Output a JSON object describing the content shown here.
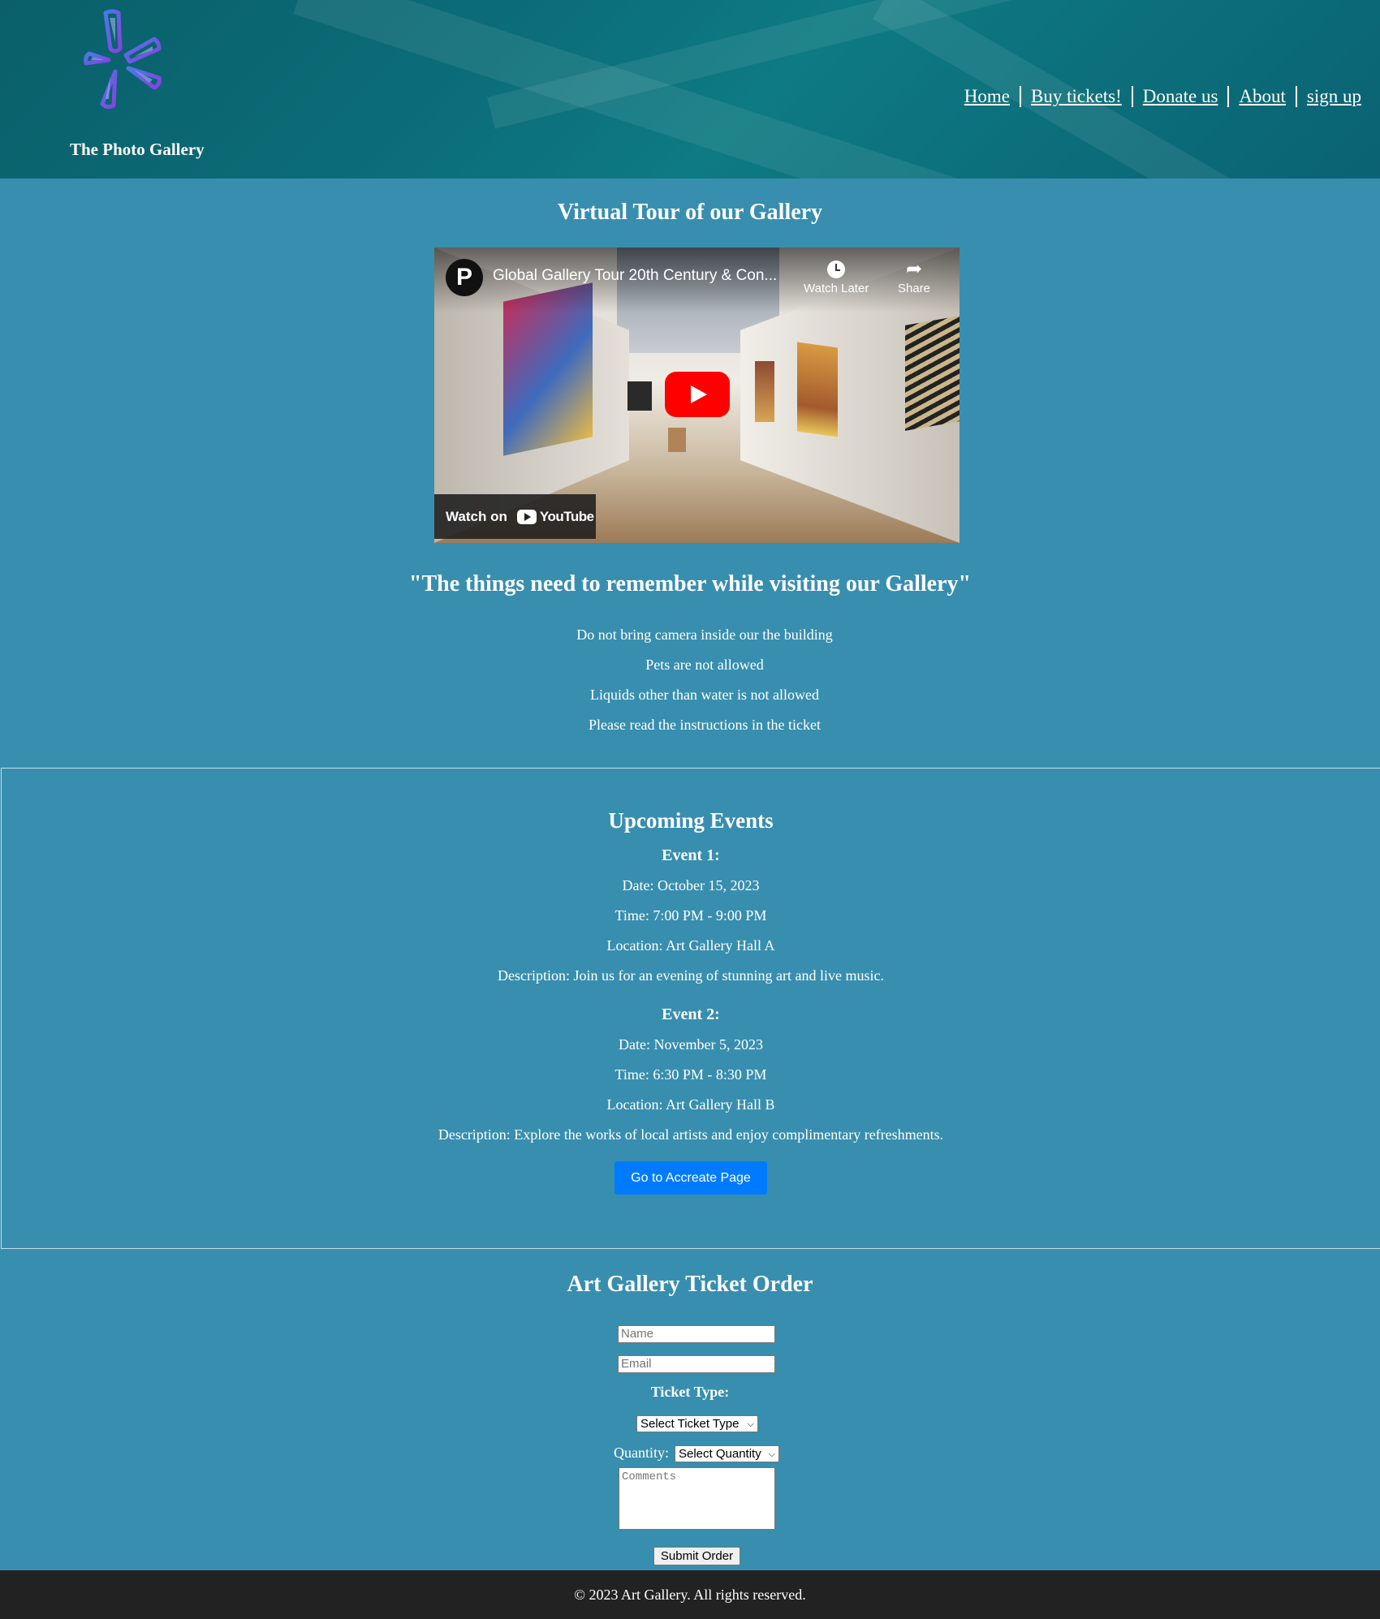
{
  "header": {
    "site_name": "The Photo Gallery",
    "logo_icon": "petal-logo-icon",
    "nav": [
      "Home",
      "Buy tickets!",
      "Donate us",
      "About",
      "sign up"
    ]
  },
  "tour": {
    "heading": "Virtual Tour of our Gallery",
    "video": {
      "channel_initial": "P",
      "title": "Global Gallery Tour 20th Century & Con...",
      "watch_later": "Watch Later",
      "share": "Share",
      "watch_on": "Watch on",
      "platform": "YouTube"
    }
  },
  "rules": {
    "heading": "\"The things need to remember while visiting our Gallery\"",
    "items": [
      "Do not bring camera inside our the building",
      "Pets are not allowed",
      "Liquids other than water is not allowed",
      "Please read the instructions in the ticket"
    ]
  },
  "events": {
    "heading": "Upcoming Events",
    "list": [
      {
        "title": "Event 1:",
        "date": "Date: October 15, 2023",
        "time": "Time: 7:00 PM - 9:00 PM",
        "location": "Location: Art Gallery Hall A",
        "description": "Description: Join us for an evening of stunning art and live music."
      },
      {
        "title": "Event 2:",
        "date": "Date: November 5, 2023",
        "time": "Time: 6:30 PM - 8:30 PM",
        "location": "Location: Art Gallery Hall B",
        "description": "Description: Explore the works of local artists and enjoy complimentary refreshments."
      }
    ],
    "button": "Go to Accreate Page"
  },
  "order": {
    "heading": "Art Gallery Ticket Order",
    "name_placeholder": "Name",
    "email_placeholder": "Email",
    "ticket_type_label": "Ticket Type:",
    "ticket_type_value": "Select Ticket Type",
    "quantity_label": "Quantity:",
    "quantity_value": "Select Quantity",
    "comments_placeholder": "Comments",
    "submit": "Submit Order"
  },
  "footer": {
    "text": "© 2023 Art Gallery. All rights reserved."
  },
  "colors": {
    "page_bg": "#388EAE",
    "footer_bg": "#222222",
    "button_blue": "#007bff"
  }
}
